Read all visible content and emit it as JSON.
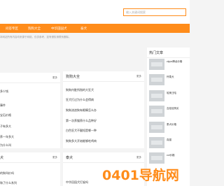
{
  "search": {
    "placeholder": "输入关键词搜索"
  },
  "nav": [
    {
      "label": "问答专区"
    },
    {
      "label": "狗狗大全"
    },
    {
      "label": "中华田园犬"
    },
    {
      "label": "泰犬"
    }
  ],
  "notice": "本网站所有内容均来源于网络，仅供参考，如有侵权请联系删除。",
  "left_panel": {
    "more": "更多",
    "items": [
      "多少钱",
      "",
      "事件",
      "宝石价格",
      "",
      "子有多大",
      "",
      "养一年多大",
      "",
      "为什么叫"
    ]
  },
  "mid_panel": {
    "title": "狗狗大全",
    "more": "更多",
    "items": [
      "狗狗内脏所指的大狂犬",
      "狂犬打过为什么会得病",
      "狗狗流浪狗有眼睛怎么办",
      "第一次养猫养什么品种好",
      "白色狂犬不腿短是哪一种",
      "狗狗多大开始能够吃鸡肉",
      "狗狗多大开始能够养"
    ]
  },
  "side": {
    "title": "热门文章",
    "items": [
      {
        "label": "zippo腾龙价格"
      },
      {
        "label": "怀柔犬"
      },
      {
        "label": "哈美汪哈"
      },
      {
        "label": "吉娃娃狗买"
      },
      {
        "label": "泰犬价格"
      },
      {
        "label": "真猫"
      },
      {
        "label": "coi价格"
      }
    ]
  },
  "bottom_left": {
    "title": "犬",
    "more": "更多",
    "items": [
      "的狗叫价吗",
      "和了什么系列"
    ]
  },
  "bottom_mid": {
    "title": "泰犬",
    "more": "更多",
    "items": [
      "中华田园犬打架吗"
    ]
  },
  "watermark": "0401导航网"
}
